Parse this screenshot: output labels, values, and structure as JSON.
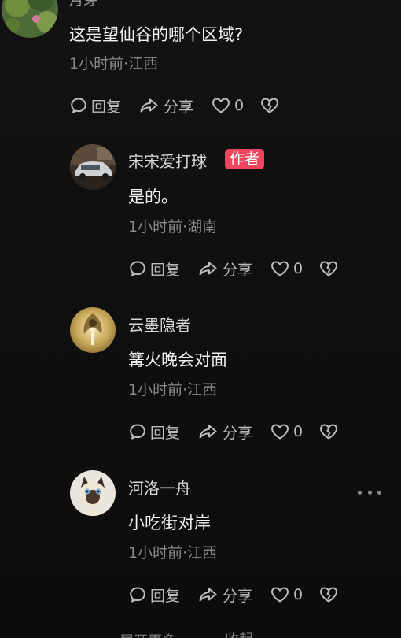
{
  "top_partial_name": "月芽",
  "comments": [
    {
      "text": "这是望仙谷的哪个区域?",
      "meta": "1小时前·江西",
      "reply_label": "回复",
      "share_label": "分享",
      "likes": "0"
    },
    {
      "username": "宋宋爱打球",
      "badge": "作者",
      "text": "是的。",
      "meta": "1小时前·湖南",
      "reply_label": "回复",
      "share_label": "分享",
      "likes": "0"
    },
    {
      "username": "云墨隐者",
      "text": "篝火晚会对面",
      "meta": "1小时前·江西",
      "reply_label": "回复",
      "share_label": "分享",
      "likes": "0"
    },
    {
      "username": "河洛一舟",
      "text": "小吃街对岸",
      "meta": "1小时前·江西",
      "reply_label": "回复",
      "share_label": "分享",
      "likes": "0"
    }
  ],
  "footer": {
    "expand_label": "展开更多",
    "collapse_label": "收起"
  },
  "icons": {
    "reply": "comment-bubble-icon",
    "share": "share-arrow-icon",
    "like": "heart-icon",
    "dislike": "broken-heart-icon",
    "more": "more-dots-icon"
  },
  "colors": {
    "background": "#0e0e0f",
    "author_badge": "#f0455e",
    "text_primary": "#f2f2f2",
    "text_secondary": "#8a8a8a"
  }
}
